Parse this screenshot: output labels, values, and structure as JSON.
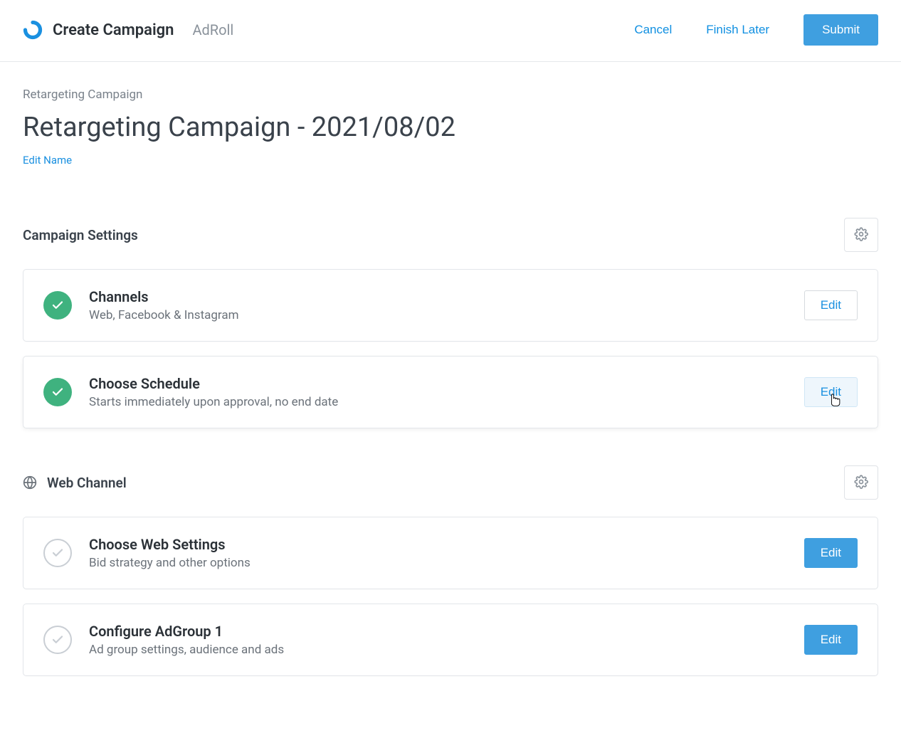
{
  "header": {
    "title": "Create Campaign",
    "brand": "AdRoll",
    "cancel": "Cancel",
    "finish_later": "Finish Later",
    "submit": "Submit"
  },
  "page": {
    "breadcrumb": "Retargeting Campaign",
    "title": "Retargeting Campaign - 2021/08/02",
    "edit_name": "Edit Name"
  },
  "sections": {
    "campaign_settings": {
      "title": "Campaign Settings",
      "cards": [
        {
          "title": "Channels",
          "desc": "Web, Facebook & Instagram",
          "edit": "Edit",
          "status": "complete",
          "edit_style": "outline"
        },
        {
          "title": "Choose Schedule",
          "desc": "Starts immediately upon approval, no end date",
          "edit": "Edit",
          "status": "complete",
          "edit_style": "hovered"
        }
      ]
    },
    "web_channel": {
      "title": "Web Channel",
      "cards": [
        {
          "title": "Choose Web Settings",
          "desc": "Bid strategy and other options",
          "edit": "Edit",
          "status": "incomplete",
          "edit_style": "solid"
        },
        {
          "title": "Configure AdGroup 1",
          "desc": "Ad group settings, audience and ads",
          "edit": "Edit",
          "status": "incomplete",
          "edit_style": "solid"
        }
      ]
    }
  }
}
